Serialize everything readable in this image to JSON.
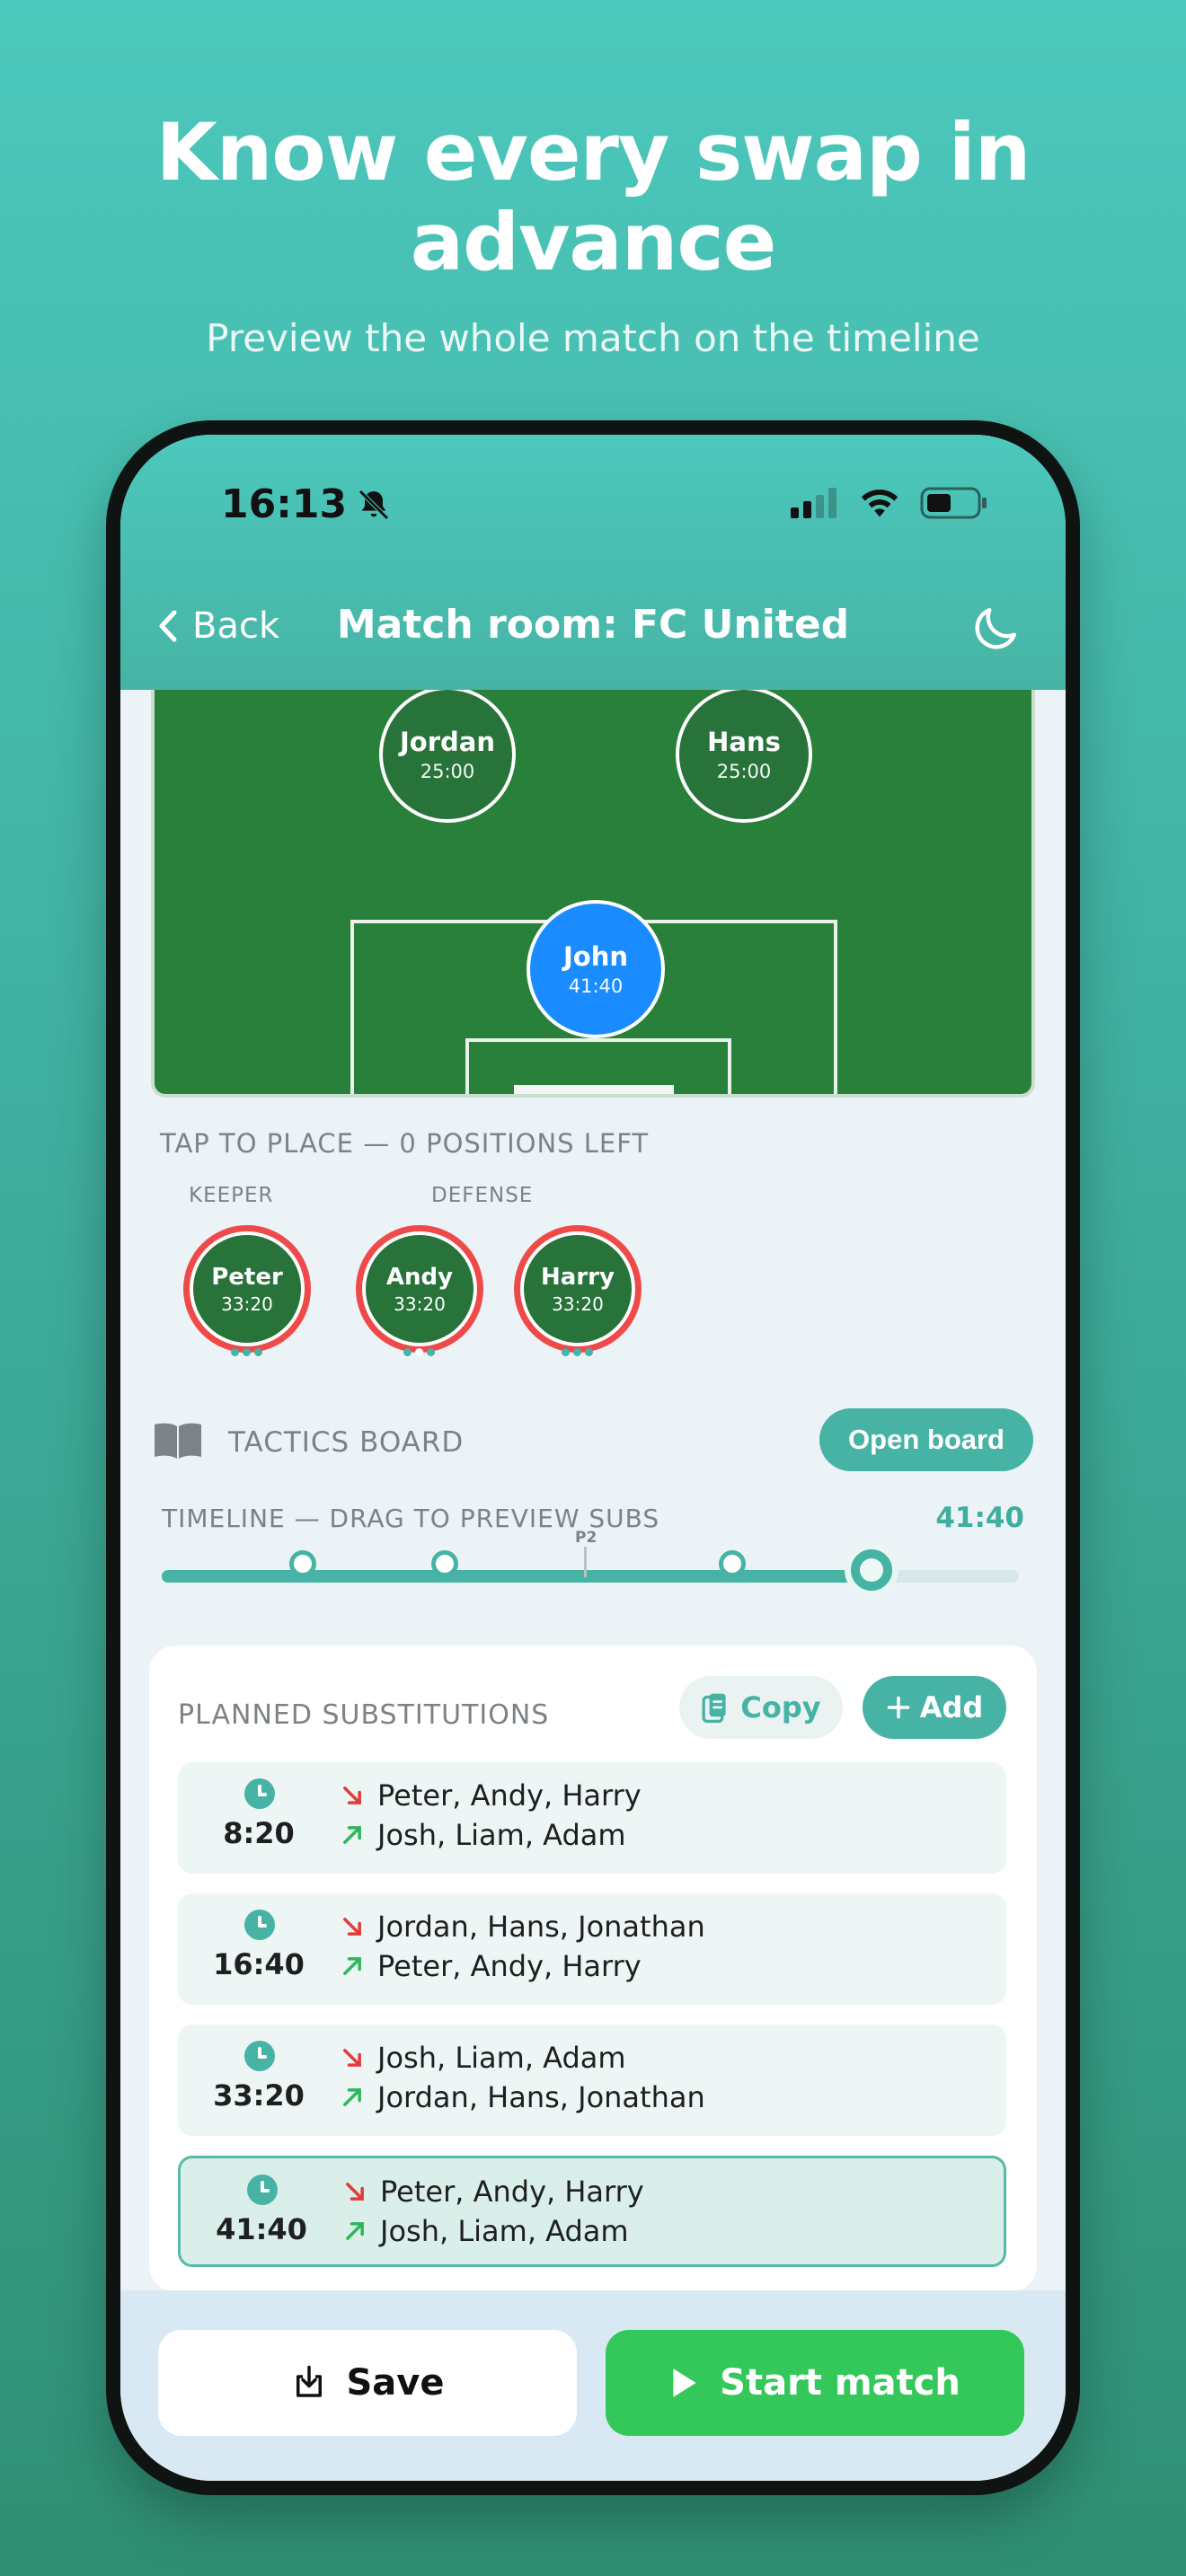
{
  "promo": {
    "headline_line1": "Know every swap in",
    "headline_line2": "advance",
    "subline": "Preview the whole match on the timeline"
  },
  "status_bar": {
    "time": "16:13"
  },
  "nav": {
    "back_label": "Back",
    "title": "Match room: FC United"
  },
  "pitch": {
    "players": [
      {
        "name": "Jordan",
        "time": "25:00",
        "role": "field"
      },
      {
        "name": "Hans",
        "time": "25:00",
        "role": "field"
      },
      {
        "name": "John",
        "time": "41:40",
        "role": "keeper"
      }
    ]
  },
  "bench": {
    "label": "TAP TO PLACE — 0 POSITIONS LEFT",
    "groups": {
      "keeper": "KEEPER",
      "defense": "DEFENSE"
    },
    "players": [
      {
        "name": "Peter",
        "time": "33:20"
      },
      {
        "name": "Andy",
        "time": "33:20"
      },
      {
        "name": "Harry",
        "time": "33:20"
      }
    ]
  },
  "tactics": {
    "label": "TACTICS BOARD",
    "open_button": "Open board"
  },
  "timeline": {
    "label": "TIMELINE — DRAG TO PREVIEW SUBS",
    "current_time": "41:40",
    "period_marker": "P2",
    "progress": 0.833
  },
  "substitutions": {
    "title": "PLANNED SUBSTITUTIONS",
    "copy_button": "Copy",
    "add_button": "Add",
    "rows": [
      {
        "time": "8:20",
        "out": "Peter, Andy, Harry",
        "in": "Josh, Liam, Adam",
        "active": false
      },
      {
        "time": "16:40",
        "out": "Jordan, Hans, Jonathan",
        "in": "Peter, Andy, Harry",
        "active": false
      },
      {
        "time": "33:20",
        "out": "Josh, Liam, Adam",
        "in": "Jordan, Hans, Jonathan",
        "active": false
      },
      {
        "time": "41:40",
        "out": "Peter, Andy, Harry",
        "in": "Josh, Liam, Adam",
        "active": true
      }
    ]
  },
  "footer": {
    "save_button": "Save",
    "start_button": "Start match"
  },
  "colors": {
    "accent": "#46b3a5",
    "pitch": "#28803a",
    "keeper": "#1a8cff",
    "bench_ring": "#ef4a4a",
    "start": "#34c759"
  }
}
